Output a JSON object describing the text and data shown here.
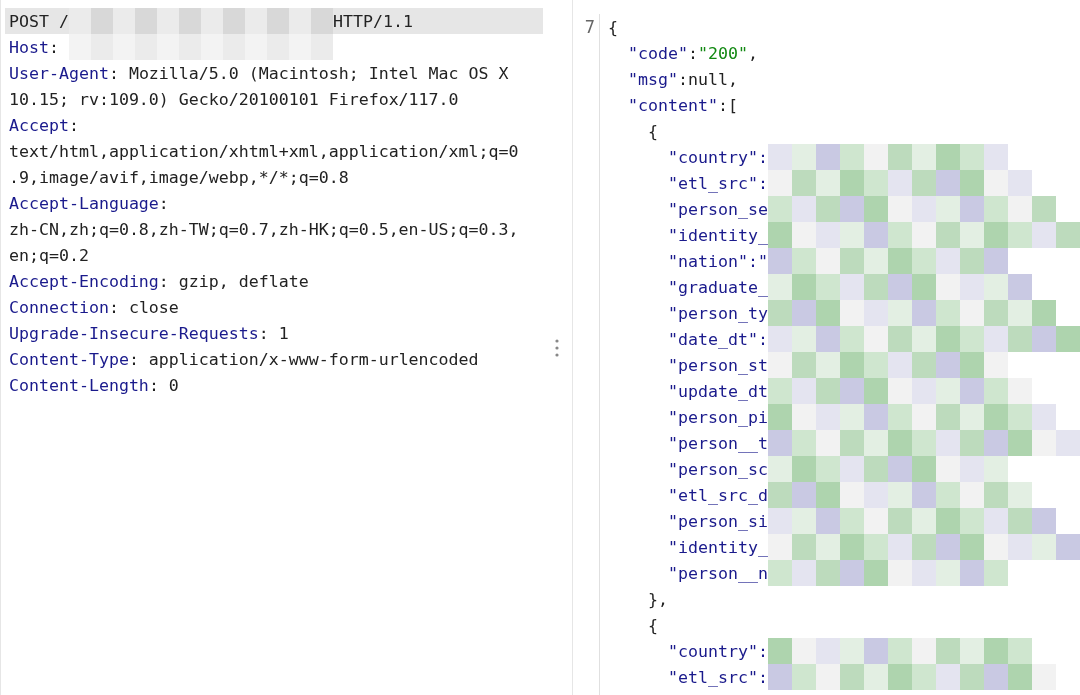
{
  "request": {
    "request_line": [
      {
        "kind": "plain",
        "text": "POST /"
      },
      {
        "kind": "redacted"
      },
      {
        "kind": "plain",
        "text": "HTTP/1.1"
      }
    ],
    "lines": [
      {
        "parts": [
          {
            "kind": "key",
            "text": "Host"
          },
          {
            "kind": "plain",
            "text": ": "
          },
          {
            "kind": "redacted"
          }
        ]
      },
      {
        "parts": [
          {
            "kind": "key",
            "text": "User-Agent"
          },
          {
            "kind": "plain",
            "text": ": Mozilla/5.0 (Macintosh; Intel Mac OS X"
          }
        ]
      },
      {
        "parts": [
          {
            "kind": "plain",
            "text": "10.15; rv:109.0) Gecko/20100101 Firefox/117.0"
          }
        ]
      },
      {
        "parts": [
          {
            "kind": "key",
            "text": "Accept"
          },
          {
            "kind": "plain",
            "text": ":"
          }
        ]
      },
      {
        "parts": [
          {
            "kind": "plain",
            "text": "text/html,application/xhtml+xml,application/xml;q=0"
          }
        ]
      },
      {
        "parts": [
          {
            "kind": "plain",
            "text": ".9,image/avif,image/webp,*/*;q=0.8"
          }
        ]
      },
      {
        "parts": [
          {
            "kind": "key",
            "text": "Accept-Language"
          },
          {
            "kind": "plain",
            "text": ":"
          }
        ]
      },
      {
        "parts": [
          {
            "kind": "plain",
            "text": "zh-CN,zh;q=0.8,zh-TW;q=0.7,zh-HK;q=0.5,en-US;q=0.3,"
          }
        ]
      },
      {
        "parts": [
          {
            "kind": "plain",
            "text": "en;q=0.2"
          }
        ]
      },
      {
        "parts": [
          {
            "kind": "key",
            "text": "Accept-Encoding"
          },
          {
            "kind": "plain",
            "text": ": gzip, deflate"
          }
        ]
      },
      {
        "parts": [
          {
            "kind": "key",
            "text": "Connection"
          },
          {
            "kind": "plain",
            "text": ": close"
          }
        ]
      },
      {
        "parts": [
          {
            "kind": "key",
            "text": "Upgrade-Insecure-Requests"
          },
          {
            "kind": "plain",
            "text": ": 1"
          }
        ]
      },
      {
        "parts": [
          {
            "kind": "key",
            "text": "Content-Type"
          },
          {
            "kind": "plain",
            "text": ": application/x-www-form-urlencoded"
          }
        ]
      },
      {
        "parts": [
          {
            "kind": "key",
            "text": "Content-Length"
          },
          {
            "kind": "plain",
            "text": ": 0"
          }
        ]
      }
    ]
  },
  "response": {
    "line_number": "7",
    "lines": [
      {
        "parts": [
          {
            "kind": "punct",
            "text": "{"
          }
        ],
        "children": [
          {
            "parts": [
              {
                "kind": "key",
                "text": "\"code\""
              },
              {
                "kind": "punct",
                "text": ":"
              },
              {
                "kind": "string",
                "text": "\"200\""
              },
              {
                "kind": "punct",
                "text": ","
              }
            ]
          },
          {
            "parts": [
              {
                "kind": "key",
                "text": "\"msg\""
              },
              {
                "kind": "punct",
                "text": ":null,"
              }
            ]
          },
          {
            "parts": [
              {
                "kind": "key",
                "text": "\"content\""
              },
              {
                "kind": "punct",
                "text": ":["
              }
            ],
            "children": [
              {
                "parts": [
                  {
                    "kind": "punct",
                    "text": "{"
                  }
                ],
                "children": [
                  {
                    "parts": [
                      {
                        "kind": "key",
                        "text": "\"country\":"
                      },
                      {
                        "kind": "redacted"
                      }
                    ]
                  },
                  {
                    "parts": [
                      {
                        "kind": "key",
                        "text": "\"etl_src\":"
                      },
                      {
                        "kind": "redacted"
                      }
                    ]
                  },
                  {
                    "parts": [
                      {
                        "kind": "key",
                        "text": "\"person_se"
                      },
                      {
                        "kind": "redacted"
                      }
                    ]
                  },
                  {
                    "parts": [
                      {
                        "kind": "key",
                        "text": "\"identity_"
                      },
                      {
                        "kind": "redacted"
                      }
                    ]
                  },
                  {
                    "parts": [
                      {
                        "kind": "key",
                        "text": "\"nation\":\""
                      },
                      {
                        "kind": "redacted"
                      }
                    ]
                  },
                  {
                    "parts": [
                      {
                        "kind": "key",
                        "text": "\"graduate_"
                      },
                      {
                        "kind": "redacted"
                      }
                    ]
                  },
                  {
                    "parts": [
                      {
                        "kind": "key",
                        "text": "\"person_ty"
                      },
                      {
                        "kind": "redacted"
                      }
                    ]
                  },
                  {
                    "parts": [
                      {
                        "kind": "key",
                        "text": "\"date_dt\":"
                      },
                      {
                        "kind": "redacted"
                      }
                    ]
                  },
                  {
                    "parts": [
                      {
                        "kind": "key",
                        "text": "\"person_st"
                      },
                      {
                        "kind": "redacted"
                      }
                    ]
                  },
                  {
                    "parts": [
                      {
                        "kind": "key",
                        "text": "\"update_dt"
                      },
                      {
                        "kind": "redacted"
                      }
                    ]
                  },
                  {
                    "parts": [
                      {
                        "kind": "key",
                        "text": "\"person_pi"
                      },
                      {
                        "kind": "redacted"
                      }
                    ]
                  },
                  {
                    "parts": [
                      {
                        "kind": "key",
                        "text": "\"person__t"
                      },
                      {
                        "kind": "redacted"
                      }
                    ]
                  },
                  {
                    "parts": [
                      {
                        "kind": "key",
                        "text": "\"person_sc"
                      },
                      {
                        "kind": "redacted"
                      }
                    ]
                  },
                  {
                    "parts": [
                      {
                        "kind": "key",
                        "text": "\"etl_src_d"
                      },
                      {
                        "kind": "redacted"
                      }
                    ]
                  },
                  {
                    "parts": [
                      {
                        "kind": "key",
                        "text": "\"person_si"
                      },
                      {
                        "kind": "redacted"
                      }
                    ]
                  },
                  {
                    "parts": [
                      {
                        "kind": "key",
                        "text": "\"identity_"
                      },
                      {
                        "kind": "redacted"
                      }
                    ]
                  },
                  {
                    "parts": [
                      {
                        "kind": "key",
                        "text": "\"person__n"
                      },
                      {
                        "kind": "redacted"
                      }
                    ]
                  }
                ]
              },
              {
                "parts": [
                  {
                    "kind": "punct",
                    "text": "},"
                  }
                ]
              },
              {
                "parts": [
                  {
                    "kind": "punct",
                    "text": "{"
                  }
                ],
                "children": [
                  {
                    "parts": [
                      {
                        "kind": "key",
                        "text": "\"country\":"
                      },
                      {
                        "kind": "redacted"
                      }
                    ]
                  },
                  {
                    "parts": [
                      {
                        "kind": "key",
                        "text": "\"etl_src\":"
                      },
                      {
                        "kind": "redacted"
                      }
                    ]
                  }
                ]
              }
            ]
          }
        ]
      }
    ]
  }
}
